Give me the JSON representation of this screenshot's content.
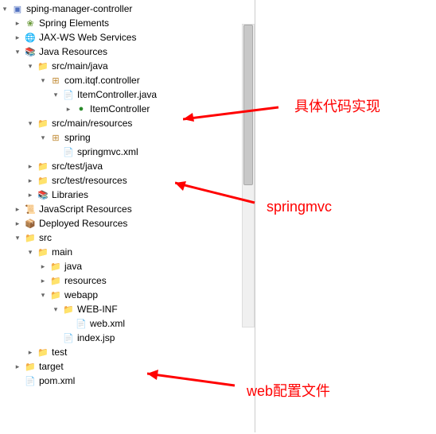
{
  "annotations": {
    "a1": "具体代码实现",
    "a2": "springmvc",
    "a3": "web配置文件"
  },
  "tree": [
    {
      "depth": 0,
      "toggle": "open",
      "icon": "proj",
      "name": "project-root",
      "label": "sping-manager-controller",
      "inter": true
    },
    {
      "depth": 1,
      "toggle": "closed",
      "icon": "spring-el",
      "name": "spring-elements",
      "label": "Spring Elements",
      "inter": true
    },
    {
      "depth": 1,
      "toggle": "closed",
      "icon": "globe",
      "name": "jaxws",
      "label": "JAX-WS Web Services",
      "inter": true
    },
    {
      "depth": 1,
      "toggle": "open",
      "icon": "lib",
      "name": "java-resources",
      "label": "Java Resources",
      "inter": true
    },
    {
      "depth": 2,
      "toggle": "open",
      "icon": "pkg-folder",
      "name": "src-main-java",
      "label": "src/main/java",
      "inter": true
    },
    {
      "depth": 3,
      "toggle": "open",
      "icon": "pkg",
      "name": "pkg-controller",
      "label": "com.itqf.controller",
      "inter": true
    },
    {
      "depth": 4,
      "toggle": "open",
      "icon": "java",
      "name": "itemcontroller-java",
      "label": "ItemController.java",
      "inter": true
    },
    {
      "depth": 5,
      "toggle": "closed",
      "icon": "class-green",
      "name": "itemcontroller-class",
      "label": "ItemController",
      "inter": true
    },
    {
      "depth": 2,
      "toggle": "open",
      "icon": "pkg-folder",
      "name": "src-main-resources",
      "label": "src/main/resources",
      "inter": true
    },
    {
      "depth": 3,
      "toggle": "open",
      "icon": "pkg",
      "name": "pkg-spring",
      "label": "spring",
      "inter": true
    },
    {
      "depth": 4,
      "toggle": "blank",
      "icon": "xml",
      "name": "springmvc-xml",
      "label": "springmvc.xml",
      "inter": true
    },
    {
      "depth": 2,
      "toggle": "closed",
      "icon": "pkg-folder",
      "name": "src-test-java",
      "label": "src/test/java",
      "inter": true
    },
    {
      "depth": 2,
      "toggle": "closed",
      "icon": "pkg-folder",
      "name": "src-test-resources",
      "label": "src/test/resources",
      "inter": true
    },
    {
      "depth": 2,
      "toggle": "closed",
      "icon": "lib",
      "name": "libraries",
      "label": "Libraries",
      "inter": true
    },
    {
      "depth": 1,
      "toggle": "closed",
      "icon": "script",
      "name": "js-resources",
      "label": "JavaScript Resources",
      "inter": true
    },
    {
      "depth": 1,
      "toggle": "closed",
      "icon": "deploy",
      "name": "deployed-resources",
      "label": "Deployed Resources",
      "inter": true
    },
    {
      "depth": 1,
      "toggle": "open",
      "icon": "folder",
      "name": "src-folder",
      "label": "src",
      "inter": true
    },
    {
      "depth": 2,
      "toggle": "open",
      "icon": "folder",
      "name": "main-folder",
      "label": "main",
      "inter": true
    },
    {
      "depth": 3,
      "toggle": "closed",
      "icon": "folder",
      "name": "java-folder",
      "label": "java",
      "inter": true
    },
    {
      "depth": 3,
      "toggle": "closed",
      "icon": "folder",
      "name": "resources-folder",
      "label": "resources",
      "inter": true
    },
    {
      "depth": 3,
      "toggle": "open",
      "icon": "folder",
      "name": "webapp-folder",
      "label": "webapp",
      "inter": true
    },
    {
      "depth": 4,
      "toggle": "open",
      "icon": "folder",
      "name": "webinf-folder",
      "label": "WEB-INF",
      "inter": true
    },
    {
      "depth": 5,
      "toggle": "blank",
      "icon": "xml",
      "name": "web-xml",
      "label": "web.xml",
      "inter": true
    },
    {
      "depth": 4,
      "toggle": "blank",
      "icon": "java",
      "name": "index-jsp",
      "label": "index.jsp",
      "inter": true
    },
    {
      "depth": 2,
      "toggle": "closed",
      "icon": "folder",
      "name": "test-folder",
      "label": "test",
      "inter": true
    },
    {
      "depth": 1,
      "toggle": "closed",
      "icon": "folder",
      "name": "target-folder",
      "label": "target",
      "inter": true
    },
    {
      "depth": 1,
      "toggle": "blank",
      "icon": "xml",
      "name": "pom-xml",
      "label": "pom.xml",
      "inter": true
    }
  ],
  "icons": {
    "proj": "▣",
    "spring-el": "❀",
    "globe": "🌐",
    "lib": "📚",
    "pkg-folder": "📁",
    "pkg": "⊞",
    "java": "📄",
    "class-green": "●",
    "xml": "📄",
    "folder": "📁",
    "script": "📜",
    "deploy": "📦"
  }
}
